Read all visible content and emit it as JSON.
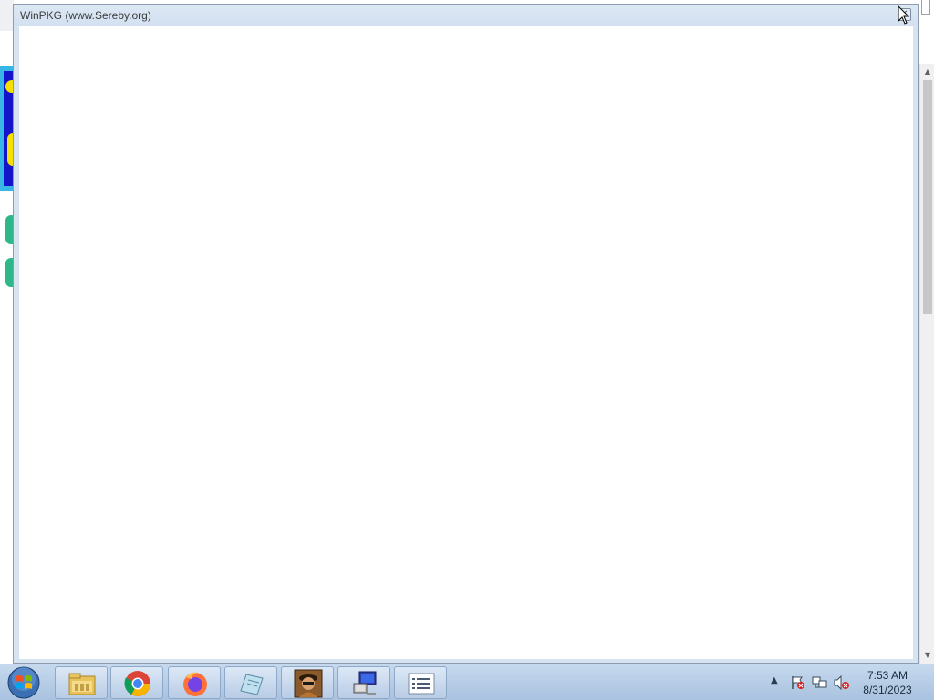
{
  "window": {
    "title": "WinPKG (www.Sereby.org)",
    "close_glyph": "✕",
    "accent": "#d6e3f1"
  },
  "background_app": {
    "scroll_up_glyph": "▲",
    "scroll_down_glyph": "▼"
  },
  "taskbar": {
    "start_icon": "windows-start-orb-icon",
    "pinned": [
      {
        "name": "file-explorer-icon"
      },
      {
        "name": "chrome-icon"
      },
      {
        "name": "firefox-icon"
      },
      {
        "name": "notepad-icon"
      },
      {
        "name": "user-avatar-app-icon"
      },
      {
        "name": "network-computer-app-icon"
      },
      {
        "name": "winpkg-list-icon"
      }
    ],
    "tray": {
      "show_hidden_glyph": "▲",
      "icons": [
        "action-center-flag-icon",
        "network-icon",
        "volume-muted-icon"
      ]
    },
    "clock": {
      "time": "7:53 AM",
      "date": "8/31/2023"
    }
  }
}
